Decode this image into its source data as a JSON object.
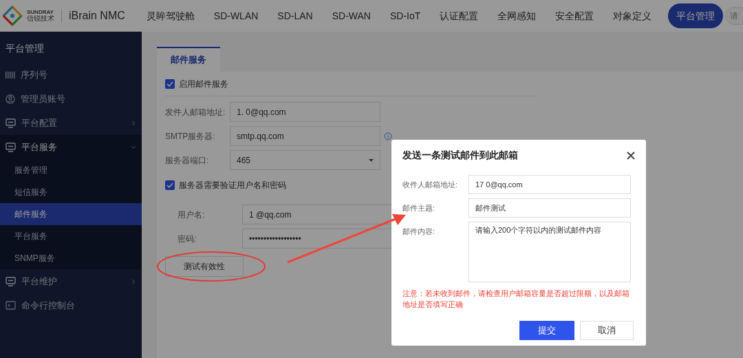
{
  "header": {
    "brand_top": "SUNDRAY",
    "brand_bottom": "信锐技术",
    "product": "iBrain NMC",
    "nav": [
      {
        "label": "灵眸驾驶舱",
        "selected": false
      },
      {
        "label": "SD-WLAN",
        "selected": false
      },
      {
        "label": "SD-LAN",
        "selected": false
      },
      {
        "label": "SD-WAN",
        "selected": false
      },
      {
        "label": "SD-IoT",
        "selected": false
      },
      {
        "label": "认证配置",
        "selected": false
      },
      {
        "label": "全网感知",
        "selected": false
      },
      {
        "label": "安全配置",
        "selected": false
      },
      {
        "label": "对象定义",
        "selected": false
      },
      {
        "label": "平台管理",
        "selected": true
      }
    ],
    "search": {
      "placeholder": "请"
    }
  },
  "sidebar": {
    "title": "平台管理",
    "items": [
      {
        "label": "序列号",
        "kind": "barcode",
        "expanded": false
      },
      {
        "label": "管理员账号",
        "kind": "user",
        "expanded": false
      },
      {
        "label": "平台配置",
        "kind": "monitor",
        "expanded": false,
        "has_children": true
      },
      {
        "label": "平台服务",
        "kind": "monitor",
        "expanded": true,
        "has_children": true,
        "children": [
          {
            "label": "服务管理",
            "selected": false
          },
          {
            "label": "短信服务",
            "selected": false
          },
          {
            "label": "邮件服务",
            "selected": true
          },
          {
            "label": "平台服务",
            "selected": false
          },
          {
            "label": "SNMP服务",
            "selected": false
          }
        ]
      },
      {
        "label": "平台维护",
        "kind": "monitor",
        "expanded": false,
        "has_children": true
      },
      {
        "label": "命令行控制台",
        "kind": "terminal",
        "expanded": false
      }
    ]
  },
  "content": {
    "tabs": [
      {
        "label": "邮件服务",
        "selected": true
      }
    ],
    "enable": {
      "label": "启用邮件服务",
      "checked": true
    },
    "fields": [
      {
        "label": "发件人邮箱地址:",
        "value": "1. 0@qq.com",
        "kind": "text"
      },
      {
        "label": "SMTP服务器:",
        "value": "smtp.qq.com",
        "kind": "text",
        "info": true
      },
      {
        "label": "服务器端口:",
        "value": "465",
        "kind": "select"
      }
    ],
    "auth": {
      "label": "服务器需要验证用户名和密码",
      "checked": true
    },
    "auth_fields": [
      {
        "label": "用户名:",
        "value": "1 @qq.com"
      },
      {
        "label": "密码:",
        "value": "••••••••••••••••••"
      }
    ],
    "test_button": "测试有效性"
  },
  "dialog": {
    "title": "发送一条测试邮件到此邮箱",
    "fields": [
      {
        "label": "收件人邮箱地址:",
        "value": "17 0@qq.com",
        "kind": "text"
      },
      {
        "label": "邮件主题:",
        "value": "邮件测试",
        "kind": "text"
      },
      {
        "label": "邮件内容:",
        "value": "请输入200个字符以内的测试邮件内容",
        "kind": "textarea"
      }
    ],
    "note": "注意：若未收到邮件，请检查用户邮箱容量是否超过限额，以及邮箱地址是否填写正确",
    "submit": "提交",
    "cancel": "取消"
  }
}
